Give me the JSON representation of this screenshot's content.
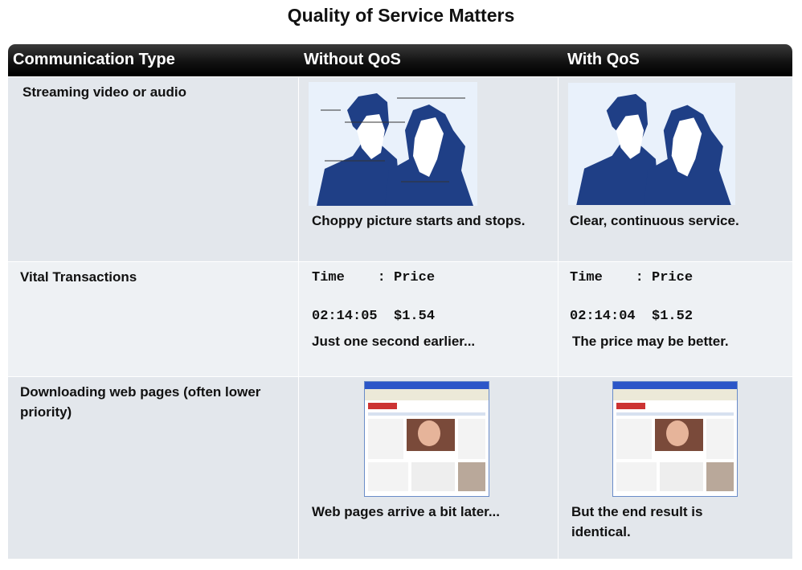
{
  "title": "Quality of Service Matters",
  "headers": [
    "Communication Type",
    "Without QoS",
    "With QoS"
  ],
  "rows": {
    "streaming": {
      "type": "Streaming video or audio",
      "without": "Choppy picture starts and stops.",
      "with": "Clear, continuous service."
    },
    "vital": {
      "type": "Vital Transactions",
      "without_header": "Time    : Price",
      "without_value": "02:14:05  $1.54",
      "without_caption": "Just one second earlier...",
      "with_header": "Time    : Price",
      "with_value": "02:14:04  $1.52",
      "with_caption": "The price may be better."
    },
    "downloading": {
      "type": "Downloading web pages (often lower priority)",
      "without": "Web pages arrive a bit later...",
      "with": "But the end result is identical."
    }
  },
  "colors": {
    "header_bg": "#1a1a1a",
    "row_bg": "#e3e7ec",
    "alt_row_bg": "#eef1f4",
    "figure_blue": "#1f3f86",
    "pic_bg": "#e9f1fb"
  }
}
